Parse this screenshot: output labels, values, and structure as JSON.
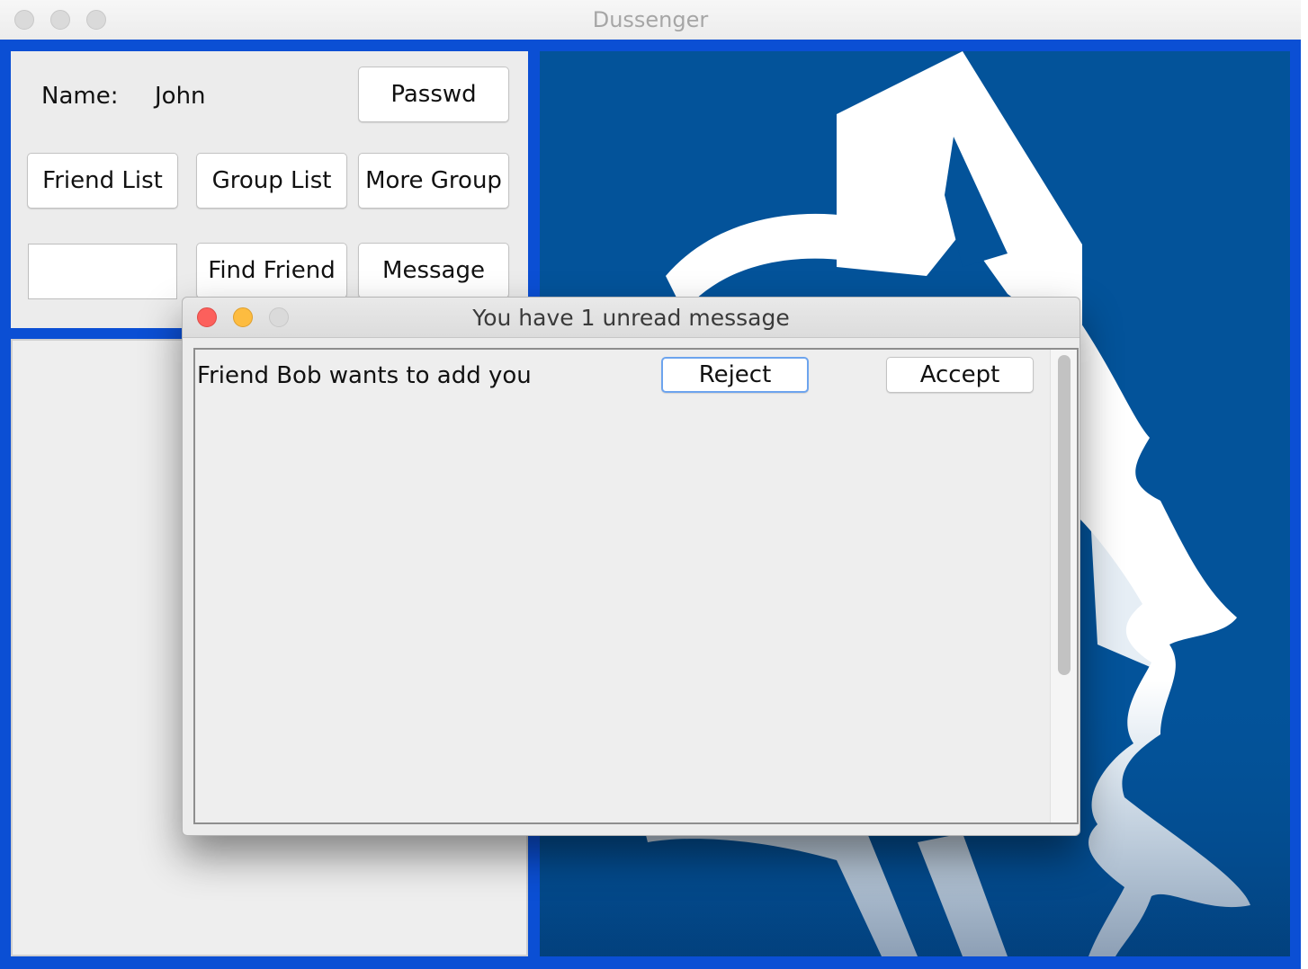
{
  "window": {
    "title": "Dussenger"
  },
  "profile": {
    "name_label": "Name:",
    "name_value": "John"
  },
  "buttons": {
    "passwd": "Passwd",
    "friend_list": "Friend List",
    "group_list": "Group List",
    "more_group": "More Group",
    "find_friend": "Find Friend",
    "message": "Message"
  },
  "search": {
    "value": ""
  },
  "dialog": {
    "title": "You have 1 unread message",
    "messages": [
      {
        "text": "Friend Bob wants to add you",
        "reject_label": "Reject",
        "accept_label": "Accept"
      }
    ]
  },
  "colors": {
    "window_frame_blue": "#0b4fd4",
    "logo_background": "#03539a",
    "close": "#fc605c",
    "minimize": "#fdbc40"
  },
  "icons": [
    "close-icon",
    "minimize-icon",
    "zoom-icon",
    "blue-devil-logo"
  ]
}
